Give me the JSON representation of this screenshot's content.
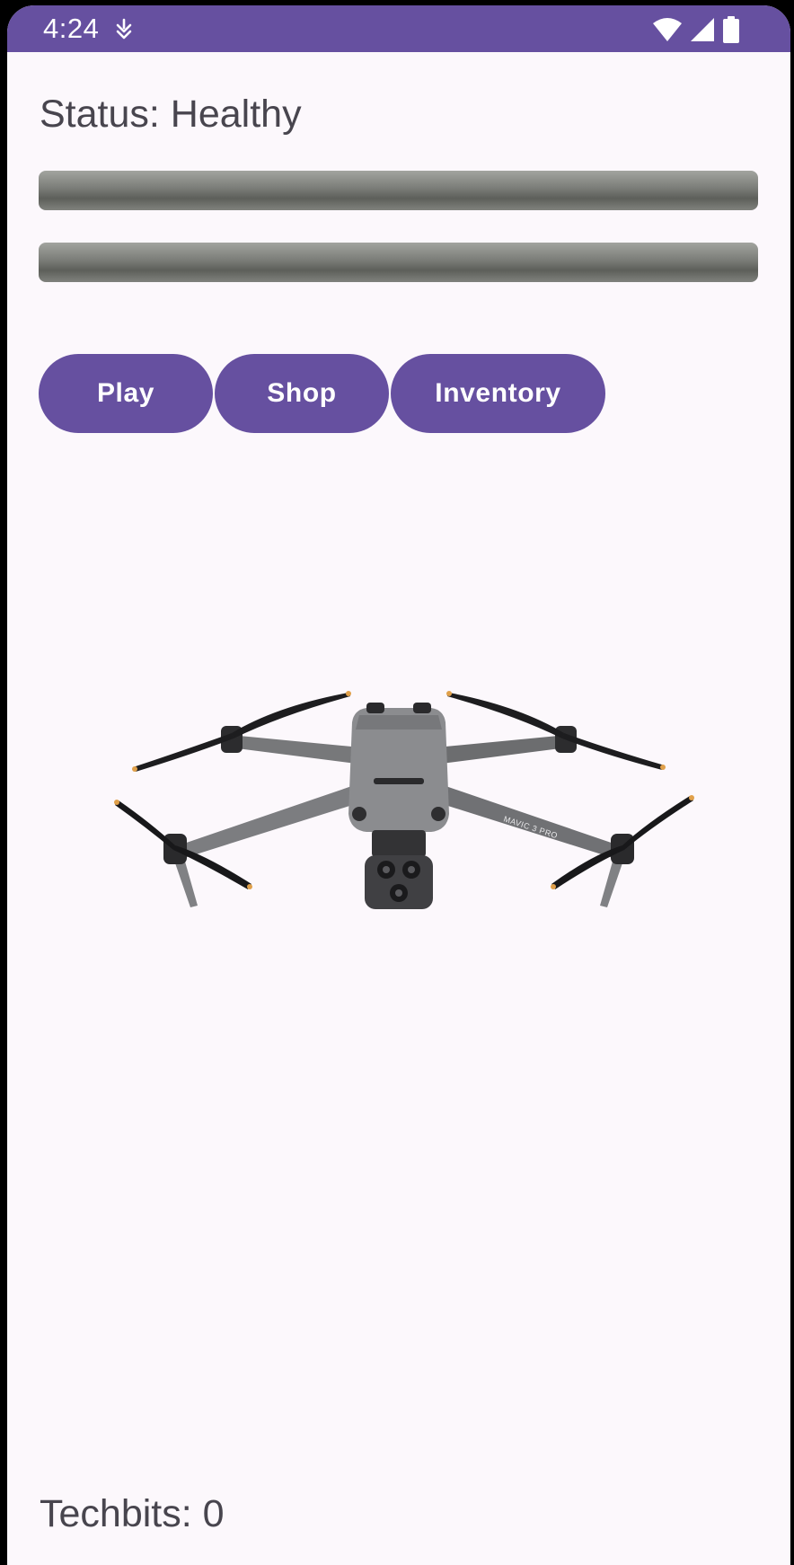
{
  "status_bar": {
    "time": "4:24",
    "notification_icon": "download-status-icon",
    "wifi_icon": "wifi-icon",
    "signal_icon": "cell-signal-icon",
    "battery_icon": "battery-icon"
  },
  "status": {
    "text": "Status: Healthy"
  },
  "meters": [
    {
      "fill_fraction": 0
    },
    {
      "fill_fraction": 0
    }
  ],
  "buttons": {
    "play": "Play",
    "shop": "Shop",
    "inventory": "Inventory"
  },
  "image": {
    "subject": "drone-image",
    "label": "MAVIC 3 PRO"
  },
  "footer": {
    "techbits": "Techbits: 0"
  },
  "colors": {
    "accent": "#6650a0",
    "background": "#fcf8fc",
    "text": "#48454e"
  }
}
